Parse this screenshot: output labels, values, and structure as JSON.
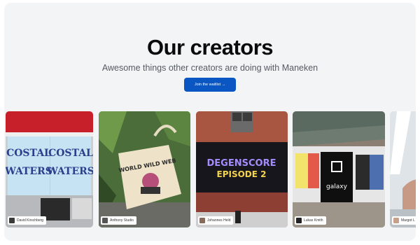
{
  "hero": {
    "title": "Our creators",
    "subtitle": "Awesome things other creators are doing with Maneken",
    "cta_label": "Join the waitlist →"
  },
  "cards": [
    {
      "creator": "David Kirschberg",
      "poster_text_1": "COSTAL",
      "poster_text_2": "WATERS"
    },
    {
      "creator": "Anthony Studio",
      "tote_text": "WORLD WILD WEB"
    },
    {
      "creator": "Johannes Held",
      "billboard_line_1": "DEGENSCORE",
      "billboard_line_2": "EPISODE 2"
    },
    {
      "creator": "Lukas Kmith",
      "wall_text": "galaxy"
    },
    {
      "creator": "Margot L"
    }
  ],
  "colors": {
    "accent": "#0a56c2",
    "panel": "#f3f4f6"
  }
}
